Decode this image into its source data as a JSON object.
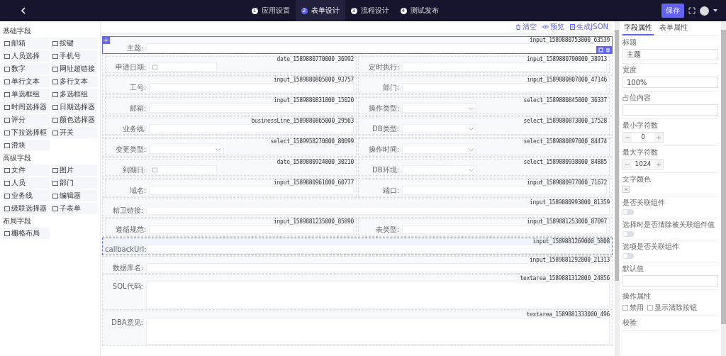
{
  "topbar": {
    "steps": [
      {
        "num": "1",
        "label": "应用设置",
        "selected": false
      },
      {
        "num": "2",
        "label": "表单设计",
        "selected": true
      },
      {
        "num": "3",
        "label": "流程设计",
        "selected": false
      },
      {
        "num": "4",
        "label": "测试发布",
        "selected": false
      }
    ],
    "save": "保存"
  },
  "sidebar": [
    {
      "title": "基础字段",
      "items": [
        "邮箱",
        "按键",
        "人员选择",
        "手机号",
        "数字",
        "网址超链接",
        "单行文本",
        "多行文本",
        "单选框组",
        "多选框组",
        "时间选择器",
        "日期选择器",
        "评分",
        "颜色选择器",
        "下拉选择框",
        "开关",
        "滑块"
      ]
    },
    {
      "title": "高级字段",
      "items": [
        "文件",
        "图片",
        "人员",
        "部门",
        "业务线",
        "编辑器",
        "级联选择器",
        "子表单"
      ]
    },
    {
      "title": "布局字段",
      "items": [
        "栅格布局"
      ]
    }
  ],
  "toolbar": [
    "清空",
    "预览",
    "生成JSON"
  ],
  "canvas": {
    "rows": [
      {
        "kind": "single",
        "selected": true,
        "hovered": false,
        "fields": [
          {
            "label": "主题:",
            "id": "input_1589880753000_63539",
            "kind": "input"
          }
        ]
      },
      {
        "kind": "pair",
        "selected": false,
        "hovered": false,
        "fields": [
          {
            "label": "申请日期:",
            "id": "date_1589880770000_36992",
            "kind": "date"
          },
          {
            "label": "定时执行:",
            "id": "input_1589880790000_38913",
            "kind": "input"
          }
        ]
      },
      {
        "kind": "pair",
        "selected": false,
        "hovered": false,
        "fields": [
          {
            "label": "工号:",
            "id": "input_1589880805000_93757",
            "kind": "input"
          },
          {
            "label": "部门:",
            "id": "input_1589880807000_47146",
            "kind": "input"
          }
        ]
      },
      {
        "kind": "pair",
        "selected": false,
        "hovered": false,
        "fields": [
          {
            "label": "邮箱:",
            "id": "input_1589880831000_15020",
            "kind": "input"
          },
          {
            "label": "操作类型:",
            "id": "select_1589880845000_36337",
            "kind": "select"
          }
        ]
      },
      {
        "kind": "pair",
        "selected": false,
        "hovered": false,
        "fields": [
          {
            "label": "业务线:",
            "id": "businessLine_1589880865000_29563",
            "kind": "input"
          },
          {
            "label": "DB类型:",
            "id": "select_1589880873000_17528",
            "kind": "select"
          }
        ]
      },
      {
        "kind": "pair",
        "selected": false,
        "hovered": false,
        "fields": [
          {
            "label": "变更类型:",
            "id": "select_1589958270000_80099",
            "kind": "select"
          },
          {
            "label": "操作时间:",
            "id": "select_1589880897000_84474",
            "kind": "select"
          }
        ]
      },
      {
        "kind": "pair",
        "selected": false,
        "hovered": false,
        "fields": [
          {
            "label": "到期日:",
            "id": "date_1589880924000_30210",
            "kind": "date"
          },
          {
            "label": "DB环境:",
            "id": "select_1589880938000_84885",
            "kind": "select"
          }
        ]
      },
      {
        "kind": "pair",
        "selected": false,
        "hovered": false,
        "fields": [
          {
            "label": "域名:",
            "id": "input_1589880961000_60777",
            "kind": "input"
          },
          {
            "label": "端口:",
            "id": "input_1589880977000_71672",
            "kind": "input"
          }
        ]
      },
      {
        "kind": "single",
        "selected": false,
        "hovered": false,
        "fields": [
          {
            "label": "精卫链接:",
            "id": "input_1589880993000_81359",
            "kind": "input"
          }
        ]
      },
      {
        "kind": "pair",
        "selected": false,
        "hovered": false,
        "fields": [
          {
            "label": "遵循规范:",
            "id": "input_1589881235000_85890",
            "kind": "input"
          },
          {
            "label": "表类型:",
            "id": "input_1589881253000_87097",
            "kind": "input"
          }
        ]
      },
      {
        "kind": "single",
        "selected": false,
        "hovered": true,
        "fields": [
          {
            "label": "callbackUrl:",
            "id": "input_1589881269000_5808",
            "kind": "input"
          }
        ]
      },
      {
        "kind": "single",
        "selected": false,
        "hovered": false,
        "fields": [
          {
            "label": "数据库名:",
            "id": "input_1589881292000_21313",
            "kind": "input"
          }
        ]
      },
      {
        "kind": "single",
        "selected": false,
        "hovered": false,
        "fields": [
          {
            "label": "SQL代码:",
            "id": "textarea_1589881312000_24856",
            "kind": "textarea"
          }
        ]
      },
      {
        "kind": "single",
        "selected": false,
        "hovered": false,
        "fields": [
          {
            "label": "DBA意见:",
            "id": "textarea_1589881333000_496",
            "kind": "textarea"
          }
        ]
      }
    ]
  },
  "panel": {
    "tabs": [
      {
        "label": "字段属性",
        "selected": true
      },
      {
        "label": "表单属性",
        "selected": false
      }
    ],
    "props": [
      {
        "kind": "text",
        "label": "标题",
        "value": "主题"
      },
      {
        "kind": "text",
        "label": "宽度",
        "value": "100%"
      },
      {
        "kind": "text",
        "label": "占位内容"
      },
      {
        "kind": "number",
        "label": "最小字符数",
        "value": "0"
      },
      {
        "kind": "number",
        "label": "最大字符数",
        "value": "1024"
      },
      {
        "kind": "color",
        "label": "文字颜色"
      },
      {
        "kind": "switch",
        "label": "是否关联组件",
        "on": false
      },
      {
        "kind": "switch",
        "label": "选择时是否清除被关联组件值",
        "on": false
      },
      {
        "kind": "switch",
        "label": "选项是否关联组件",
        "on": false
      },
      {
        "kind": "text",
        "label": "默认值"
      },
      {
        "kind": "checks",
        "label": "操作属性",
        "options": [
          {
            "label": "禁用",
            "checked": false
          },
          {
            "label": "显示清除按钮",
            "checked": false
          }
        ]
      },
      {
        "kind": "heading",
        "label": "校验"
      }
    ]
  }
}
